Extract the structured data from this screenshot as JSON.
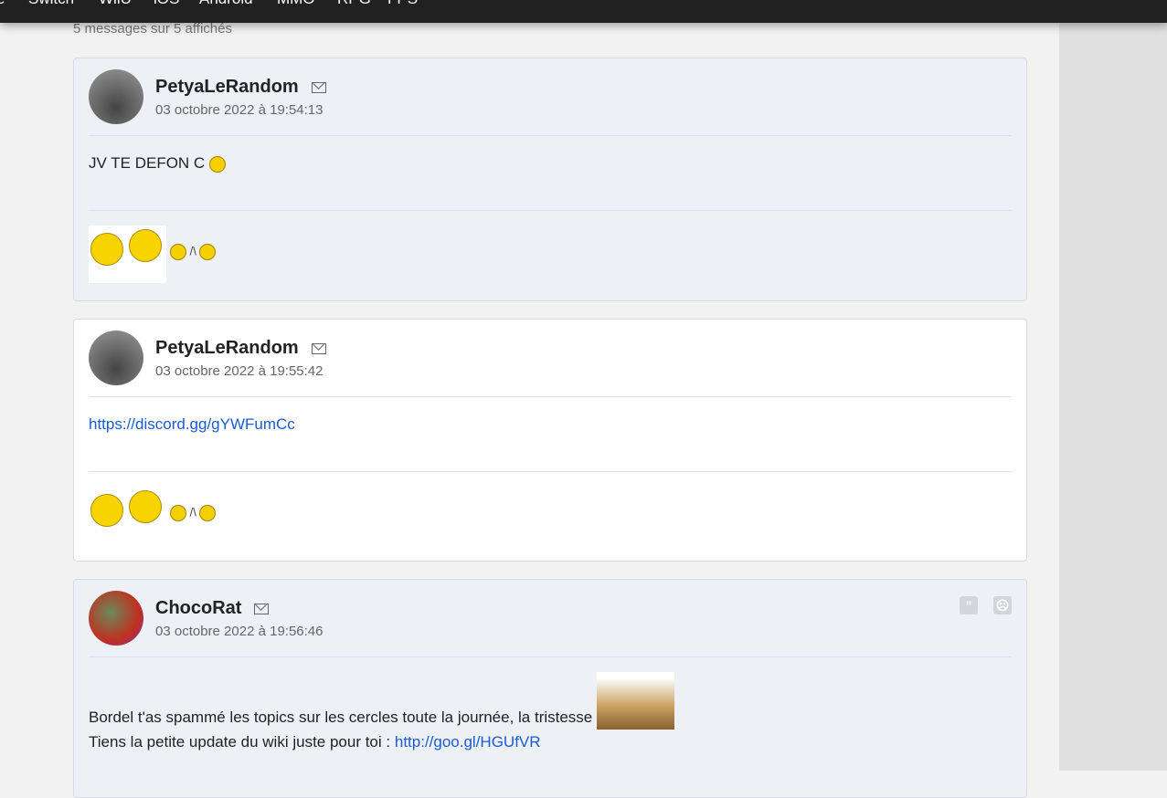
{
  "nav": [
    "e",
    "Switch",
    "WiiU",
    "iOS",
    "Android",
    "MMO",
    "RPG",
    "FPS"
  ],
  "count_text": "5 messages sur 5 affichés",
  "posts": [
    {
      "author": "PetyaLeRandom",
      "date": "03 octobre 2022 à 19:54:13",
      "text": "JV TE DEFON C",
      "sig": "/\\"
    },
    {
      "author": "PetyaLeRandom",
      "date": "03 octobre 2022 à 19:55:42",
      "link": "https://discord.gg/gYWFumCc",
      "sig": "/\\"
    },
    {
      "author": "ChocoRat",
      "date": "03 octobre 2022 à 19:56:46",
      "line1": "Bordel t'as spammé les topics sur les cercles toute la journée, la tristesse",
      "line2": "Tiens la petite update du wiki juste pour toi :",
      "link": "http://goo.gl/HGUfVR",
      "quote_icon": "quote-icon",
      "report_icon": "sad-face-icon"
    }
  ]
}
